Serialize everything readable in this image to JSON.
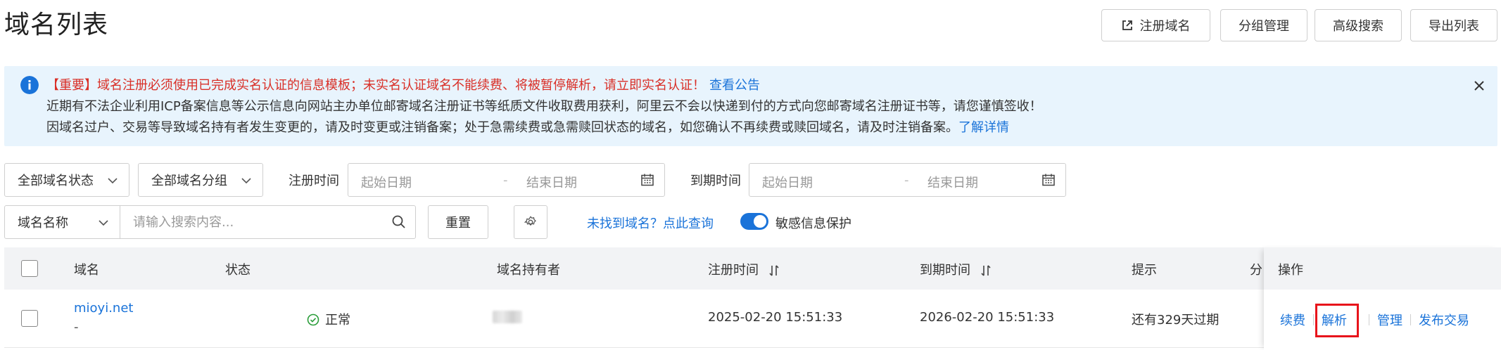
{
  "page": {
    "title": "域名列表"
  },
  "toolbar": {
    "register": "注册域名",
    "group_manage": "分组管理",
    "advanced_search": "高级搜索",
    "export_list": "导出列表"
  },
  "notice": {
    "line1": "【重要】域名注册必须使用已完成实名认证的信息模板；未实名认证域名不能续费、将被暂停解析，请立即实名认证！",
    "line1_link": "查看公告",
    "line2": "近期有不法企业利用ICP备案信息等公示信息向网站主办单位邮寄域名注册证书等纸质文件收取费用获利，阿里云不会以快递到付的方式向您邮寄域名注册证书等，请您谨慎签收！",
    "line3": "因域名过户、交易等导致域名持有者发生变更的，请及时变更或注销备案；处于急需续费或急需赎回状态的域名，如您确认不再续费或赎回域名，请及时注销备案。",
    "line3_link": "了解详情"
  },
  "filters": {
    "status_select": "全部域名状态",
    "group_select": "全部域名分组",
    "reg_time_label": "注册时间",
    "exp_time_label": "到期时间",
    "start_placeholder": "起始日期",
    "end_placeholder": "结束日期",
    "separator": "-",
    "name_select": "域名名称",
    "search_placeholder": "请输入搜索内容...",
    "reset": "重置",
    "not_found_link": "未找到域名？点此查询",
    "privacy_toggle_label": "敏感信息保护",
    "privacy_toggle_on": true
  },
  "table": {
    "columns": {
      "domain": "域名",
      "status": "状态",
      "holder": "域名持有者",
      "reg_time": "注册时间",
      "exp_time": "到期时间",
      "hint": "提示",
      "group_partial": "分",
      "ops": "操作"
    },
    "rows": [
      {
        "domain": "mioyi.net",
        "sub": "-",
        "status": "正常",
        "reg_time": "2025-02-20 15:51:33",
        "exp_time": "2026-02-20 15:51:33",
        "hint": "还有329天过期",
        "ops": [
          "续费",
          "解析",
          "管理",
          "发布交易"
        ]
      }
    ]
  },
  "colors": {
    "accent": "#1a73d9",
    "warning_text": "#d92f27",
    "highlight": "#e8141b",
    "notice_bg": "#e8f4fd"
  }
}
